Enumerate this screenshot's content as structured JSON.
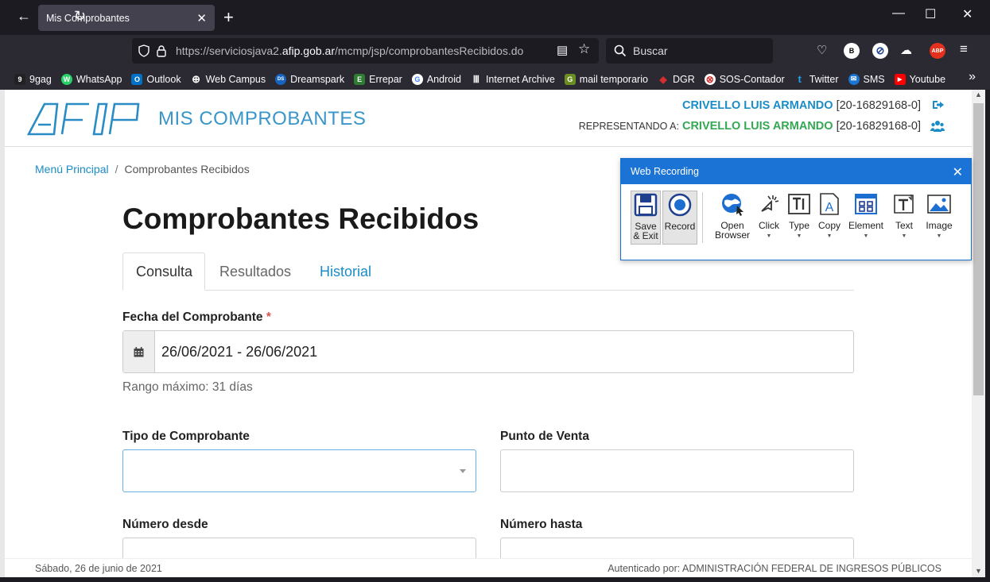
{
  "browser": {
    "tab_title": "Mis Comprobantes",
    "tab_close": "✕",
    "new_tab": "+",
    "url_prefix": "https://serviciosjava2.",
    "url_host": "afip.gob.ar",
    "url_path": "/mcmp/jsp/comprobantesRecibidos.do",
    "search_placeholder": "Buscar",
    "bookmarks": [
      {
        "label": "9gag",
        "color": "#222222",
        "glyph": "9"
      },
      {
        "label": "WhatsApp",
        "color": "#25d366",
        "glyph": "W"
      },
      {
        "label": "Outlook",
        "color": "#0072c6",
        "glyph": "O"
      },
      {
        "label": "Web Campus",
        "color": "#555555",
        "glyph": "⊕"
      },
      {
        "label": "Dreamspark",
        "color": "#1565c0",
        "glyph": "DS"
      },
      {
        "label": "Errepar",
        "color": "#2e7d32",
        "glyph": "E"
      },
      {
        "label": "Android",
        "color": "#ffffff",
        "glyph": "G"
      },
      {
        "label": "Internet Archive",
        "color": "#444444",
        "glyph": "Ⅲ"
      },
      {
        "label": "mail temporario",
        "color": "#6b8e23",
        "glyph": "G"
      },
      {
        "label": "DGR",
        "color": "#d32f2f",
        "glyph": "◆"
      },
      {
        "label": "SOS-Contador",
        "color": "#ffffff",
        "glyph": "⊗"
      },
      {
        "label": "Twitter",
        "color": "#1da1f2",
        "glyph": "t"
      },
      {
        "label": "SMS",
        "color": "#1976d2",
        "glyph": "✉"
      },
      {
        "label": "Youtube",
        "color": "#ff0000",
        "glyph": "▶"
      }
    ],
    "extensions": [
      {
        "glyph": "B",
        "bg": "#ffffff",
        "fg": "#000000"
      },
      {
        "glyph": "⊘",
        "bg": "#ffffff",
        "fg": "#1c3f94"
      },
      {
        "glyph": "ABP",
        "bg": "#e3311d",
        "fg": "#ffffff"
      }
    ]
  },
  "header": {
    "app_title": "MIS COMPROBANTES",
    "user_name": "CRIVELLO LUIS ARMANDO",
    "user_cuit": "[20-16829168-0]",
    "rep_label": "REPRESENTANDO A:",
    "rep_name": "CRIVELLO LUIS ARMANDO",
    "rep_cuit": "[20-16829168-0]"
  },
  "breadcrumb": {
    "home": "Menú Principal",
    "separator": "/",
    "current": "Comprobantes Recibidos"
  },
  "page": {
    "heading": "Comprobantes Recibidos",
    "tabs": [
      "Consulta",
      "Resultados",
      "Historial"
    ],
    "fecha_label": "Fecha del Comprobante",
    "required_mark": "*",
    "fecha_value": "26/06/2021 - 26/06/2021",
    "fecha_help": "Rango máximo: 31 días",
    "tipo_label": "Tipo de Comprobante",
    "punto_label": "Punto de Venta",
    "numero_desde_label": "Número desde",
    "numero_hasta_label": "Número hasta"
  },
  "footer": {
    "date": "Sábado, 26 de junio de 2021",
    "authenticated": "Autenticado por: ADMINISTRACIÓN FEDERAL DE INGRESOS PÚBLICOS"
  },
  "recorder": {
    "title": "Web Recording",
    "save_line1": "Save",
    "save_line2": "& Exit",
    "record": "Record",
    "open_line1": "Open",
    "open_line2": "Browser",
    "click": "Click",
    "type": "Type",
    "copy": "Copy",
    "element": "Element",
    "text": "Text",
    "image": "Image"
  }
}
